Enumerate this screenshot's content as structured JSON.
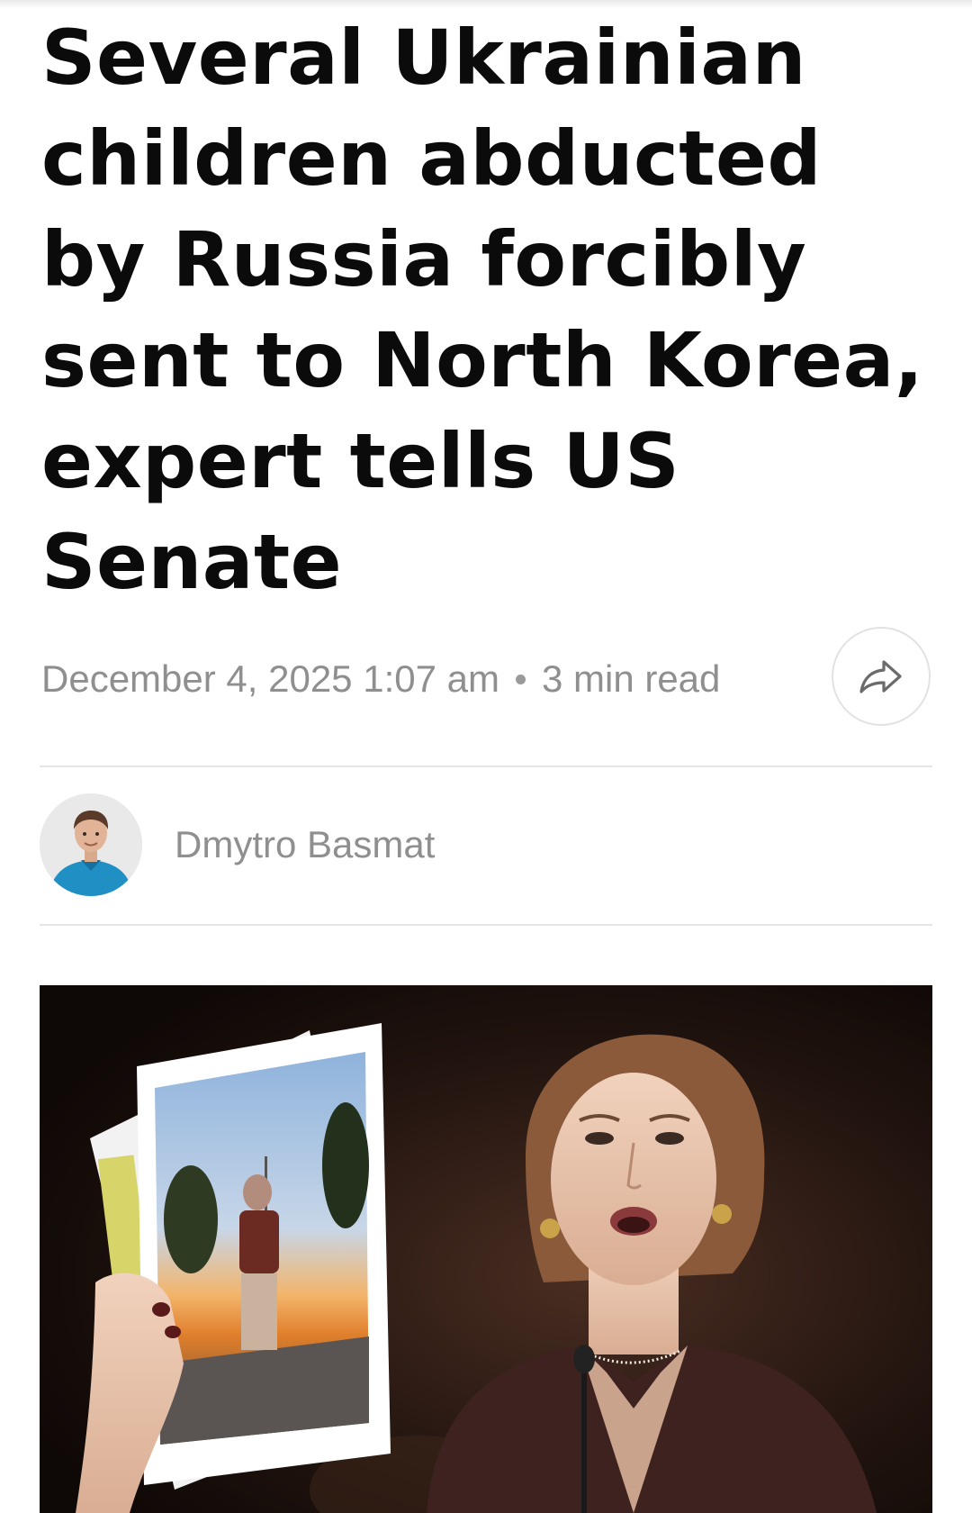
{
  "article": {
    "headline": "Several Ukrainian children abducted by Russia forcibly sent to North Korea, expert tells US Senate",
    "date": "December 4, 2025 1:07 am",
    "read_time": "3 min read"
  },
  "share": {
    "icon": "share-arrow-icon"
  },
  "author": {
    "name": "Dmytro Basmat",
    "avatar_icon": "author-avatar"
  },
  "hero_image": {
    "icon": "hero-photo"
  },
  "colors": {
    "headline": "#0b0b0b",
    "meta_text": "#8f8f8f",
    "divider": "#e6e6e6",
    "avatar_shirt": "#1f8fc4"
  }
}
